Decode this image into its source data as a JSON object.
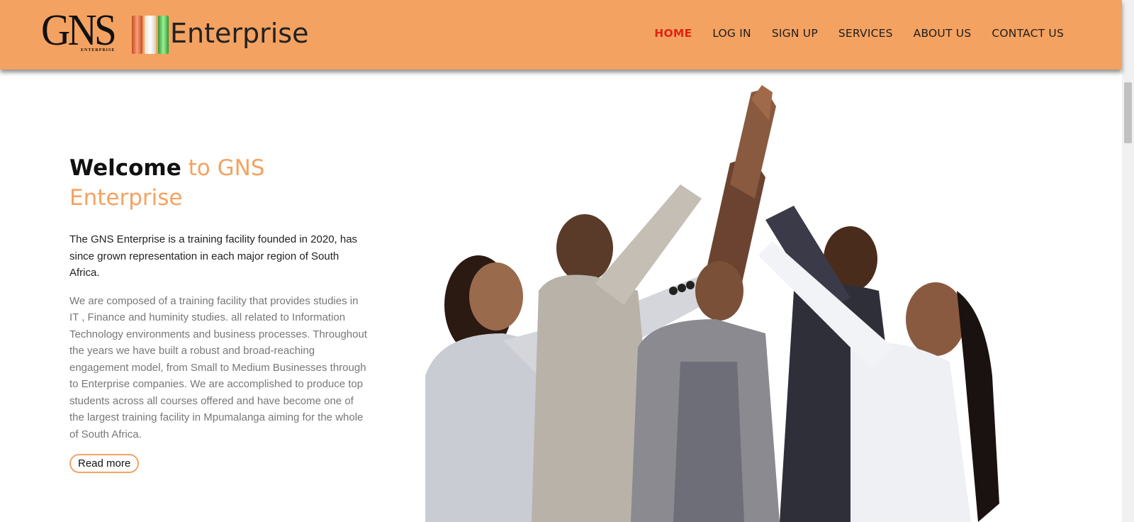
{
  "brand": {
    "logo_letters": "GNS",
    "logo_subtext": "ENTERPRISE",
    "name": "Enterprise"
  },
  "nav": [
    {
      "label": "HOME",
      "active": true
    },
    {
      "label": "LOG IN",
      "active": false
    },
    {
      "label": "SIGN UP",
      "active": false
    },
    {
      "label": "SERVICES",
      "active": false
    },
    {
      "label": "ABOUT US",
      "active": false
    },
    {
      "label": "CONTACT US",
      "active": false
    }
  ],
  "hero": {
    "title_strong": "Welcome",
    "title_accent": " to GNS Enterprise",
    "lead": "The GNS Enterprise is a training facility founded in 2020, has since grown representation in each major region of South Africa.",
    "body": "We are composed of a training facility that provides studies in IT , Finance and huminity studies. all related to Information Technology environments and business processes. Throughout the years we have built a robust and broad-reaching engagement model, from Small to Medium Businesses through to Enterprise companies. We are accomplished to produce top students across all courses offered and have become one of the largest training facility in Mpumalanga aiming for the whole of South Africa.",
    "read_more_label": "Read more"
  },
  "colors": {
    "header_bg": "#f4a261",
    "accent": "#f4a261",
    "active_nav": "#e02510"
  }
}
